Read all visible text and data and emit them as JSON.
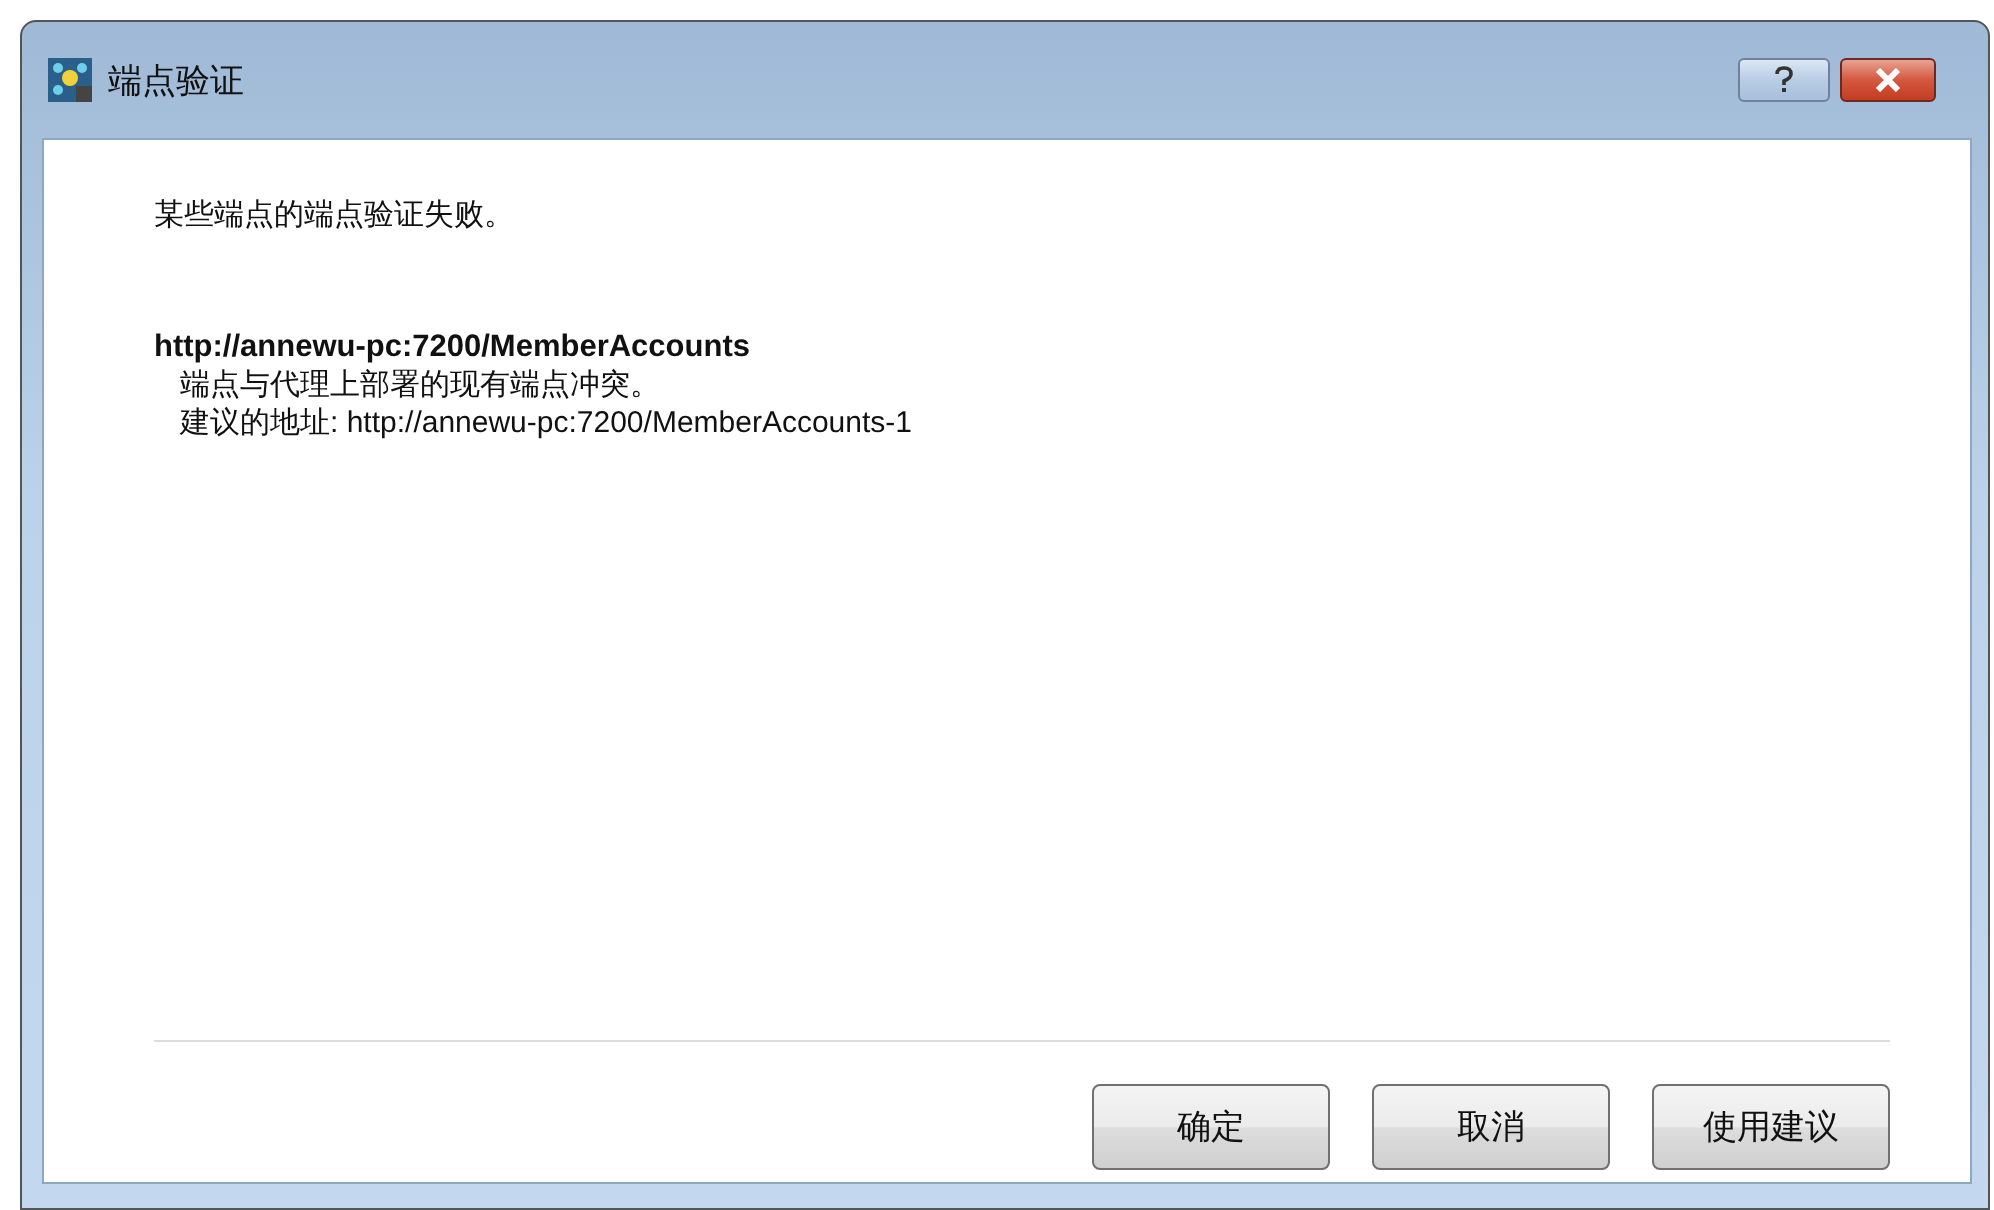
{
  "window": {
    "title": "端点验证"
  },
  "message": "某些端点的端点验证失败。",
  "endpoint": {
    "url": "http://annewu-pc:7200/MemberAccounts",
    "details": [
      "端点与代理上部署的现有端点冲突。",
      "建议的地址: http://annewu-pc:7200/MemberAccounts-1"
    ]
  },
  "buttons": [
    "确定",
    "取消",
    "使用建议"
  ]
}
